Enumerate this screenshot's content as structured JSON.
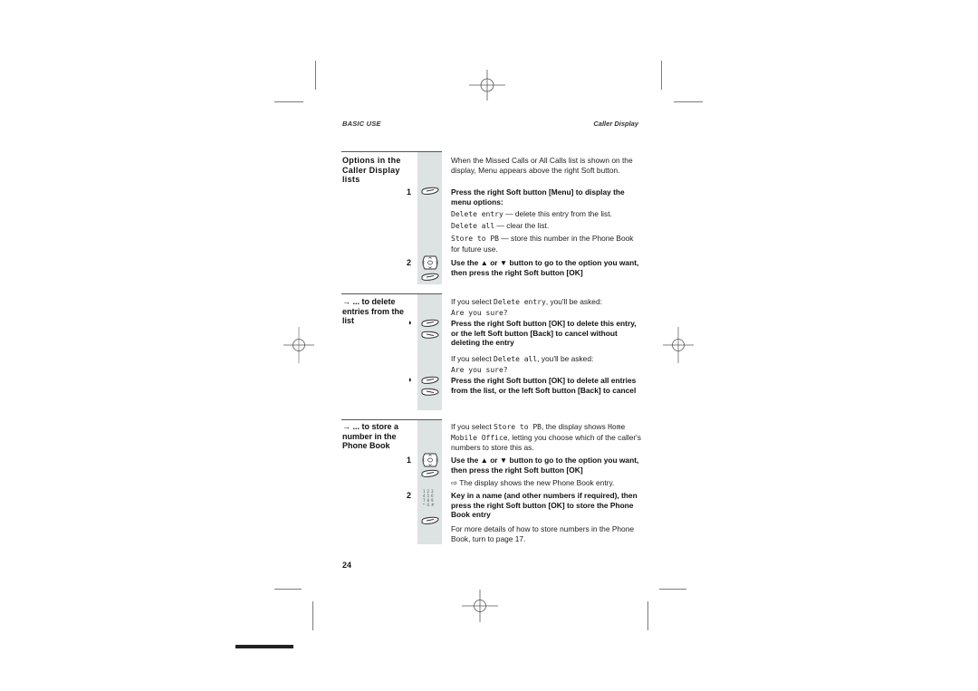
{
  "header": {
    "left": "BASIC USE",
    "right": "Caller Display"
  },
  "sections": [
    {
      "label": "Options in the Caller Display lists",
      "intro": "When the Missed Calls or All Calls list is shown on the display, Menu appears above the right Soft button.",
      "steps": [
        {
          "number": "1",
          "icon": "soft-button-icon",
          "instruction": "Press the right Soft button [Menu] to display the menu options:",
          "options": [
            {
              "term": "Delete entry",
              "desc": " — delete this entry from the list."
            },
            {
              "term": "Delete all",
              "desc": " — clear the list."
            },
            {
              "term": "Store to PB",
              "desc": " — store this number in the Phone Book for future use."
            }
          ]
        },
        {
          "number": "2",
          "icon": "navigation-key-icon",
          "instruction": "Use the ▲ or ▼ button to go to the option you want, then press the right Soft button [OK]"
        }
      ]
    },
    {
      "label": "→ ... to delete entries from the list",
      "blocks": [
        {
          "pre_a": "If you select ",
          "pre_term": "Delete entry",
          "pre_b": ", you'll be asked:",
          "prompt": "Are you sure?",
          "instruction": "Press the right Soft button [OK] to delete this entry, or the left Soft button [Back] to cancel without deleting the entry"
        },
        {
          "pre_a": "If you select ",
          "pre_term": "Delete all",
          "pre_b": ", you'll be asked:",
          "prompt": "Are you sure?",
          "instruction": "Press the right Soft button [OK] to delete all entries from the list, or the left Soft button [Back] to cancel"
        }
      ]
    },
    {
      "label": "→ ... to store a number in the Phone Book",
      "intro_a": "If you select ",
      "intro_term1": "Store to PB",
      "intro_b": ", the display shows ",
      "intro_term2": "Home Mobile Office",
      "intro_c": ", letting you choose which of the caller's numbers to store this as.",
      "steps": [
        {
          "number": "1",
          "instruction": "Use the ▲ or ▼ button to go to the option you want, then press the right Soft button [OK]",
          "result": "⇨ The display shows the new Phone Book entry."
        },
        {
          "number": "2",
          "instruction": "Key in a name (and other numbers if required), then press the right Soft button [OK] to store the Phone Book entry",
          "note": "For more details of how to store numbers in the Phone Book, turn to page 17."
        }
      ]
    }
  ],
  "bullet_glyph": "◗",
  "page_number": "24",
  "colors": {
    "gray_column": "#dde2e2",
    "text": "#1a1a1a",
    "crop_marks": "#7a7a7a"
  }
}
